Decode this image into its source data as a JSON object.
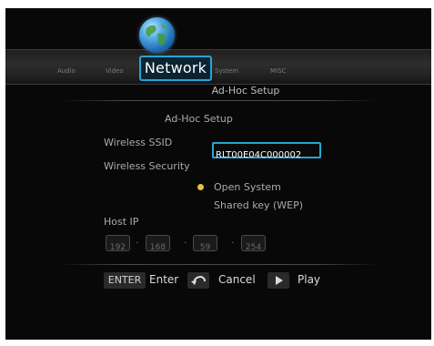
{
  "tabs": [
    {
      "label": "Audio"
    },
    {
      "label": "Video"
    },
    {
      "label": "Network"
    },
    {
      "label": "System"
    },
    {
      "label": "MISC"
    }
  ],
  "header_title": "Ad-Hoc Setup",
  "form": {
    "section_title": "Ad-Hoc Setup",
    "ssid_label": "Wireless SSID",
    "ssid_value": "RLT00E04C000002",
    "security_label": "Wireless Security",
    "security_options": [
      {
        "label": "Open System",
        "selected": true
      },
      {
        "label": "Shared key (WEP)",
        "selected": false
      }
    ],
    "host_ip_label": "Host IP",
    "host_ip": [
      "192",
      "168",
      "59",
      "254"
    ]
  },
  "hints": {
    "enter_key": "ENTER",
    "enter_label": "Enter",
    "cancel_label": "Cancel",
    "play_label": "Play"
  },
  "colors": {
    "accent": "#26a6d6",
    "selected_dot": "#e3c33a",
    "background": "#080808"
  },
  "icons": {
    "network": "globe-icon",
    "cancel": "return-arrow-icon",
    "play": "play-icon"
  }
}
